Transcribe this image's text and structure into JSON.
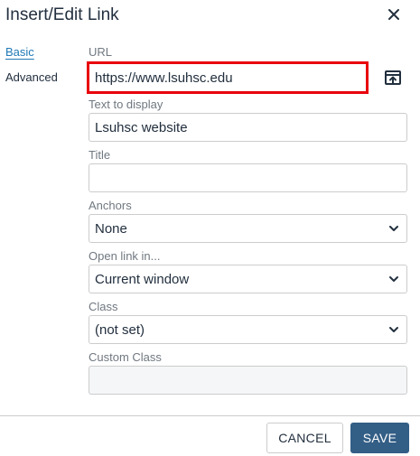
{
  "dialog": {
    "title": "Insert/Edit Link"
  },
  "tabs": [
    {
      "label": "Basic",
      "active": true
    },
    {
      "label": "Advanced",
      "active": false
    }
  ],
  "fields": {
    "url": {
      "label": "URL",
      "value": "https://www.lsuhsc.edu"
    },
    "text_to_display": {
      "label": "Text to display",
      "value": "Lsuhsc website"
    },
    "title": {
      "label": "Title",
      "value": ""
    },
    "anchors": {
      "label": "Anchors",
      "value": "None"
    },
    "open_link_in": {
      "label": "Open link in...",
      "value": "Current window"
    },
    "class": {
      "label": "Class",
      "value": "(not set)"
    },
    "custom_class": {
      "label": "Custom Class",
      "value": ""
    }
  },
  "footer": {
    "cancel_label": "CANCEL",
    "save_label": "SAVE"
  },
  "colors": {
    "accent": "#207ab7",
    "save_button": "#335e86",
    "highlight": "#e8000b"
  },
  "icons": {
    "close": "close-icon",
    "browse": "browse-icon",
    "chevron": "chevron-down-icon"
  }
}
